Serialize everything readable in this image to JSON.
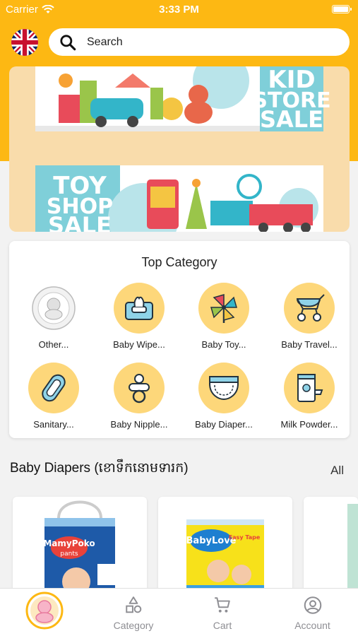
{
  "status_bar": {
    "carrier": "Carrier",
    "time": "3:33 PM"
  },
  "header": {
    "language_flag": "uk-flag-icon",
    "search": {
      "placeholder": "Search"
    }
  },
  "banner": {
    "top": {
      "line1": "KID",
      "line2": "STORE",
      "line3": "SALE"
    },
    "bottom": {
      "line1": "TOY",
      "line2": "SHOP",
      "line3": "SALE"
    }
  },
  "top_category": {
    "title": "Top Category",
    "items": [
      {
        "label": "Other...",
        "icon": "shop-logo-icon"
      },
      {
        "label": "Baby Wipe...",
        "icon": "wipes-icon"
      },
      {
        "label": "Baby Toy...",
        "icon": "pinwheel-icon"
      },
      {
        "label": "Baby Travel...",
        "icon": "stroller-icon"
      },
      {
        "label": "Sanitary...",
        "icon": "sanitary-pad-icon"
      },
      {
        "label": "Baby Nipple...",
        "icon": "pacifier-icon"
      },
      {
        "label": "Baby Diaper...",
        "icon": "diaper-icon"
      },
      {
        "label": "Milk Powder...",
        "icon": "milk-can-icon"
      }
    ]
  },
  "section": {
    "title": "Baby Diapers (ខោទឹកនោមទារក)",
    "all_label": "All"
  },
  "products": [
    {
      "brand": "MamyPoko",
      "sub": "pants"
    },
    {
      "brand": "BabyLove",
      "sub": "Easy Tape"
    }
  ],
  "tabbar": {
    "items": [
      {
        "label": "",
        "icon": "home-logo-icon"
      },
      {
        "label": "Category",
        "icon": "category-icon"
      },
      {
        "label": "Cart",
        "icon": "cart-icon"
      },
      {
        "label": "Account",
        "icon": "account-icon"
      }
    ]
  },
  "colors": {
    "brand": "#fdb813",
    "category_circle": "#fdd77a",
    "tab_inactive": "#8e8e93"
  }
}
